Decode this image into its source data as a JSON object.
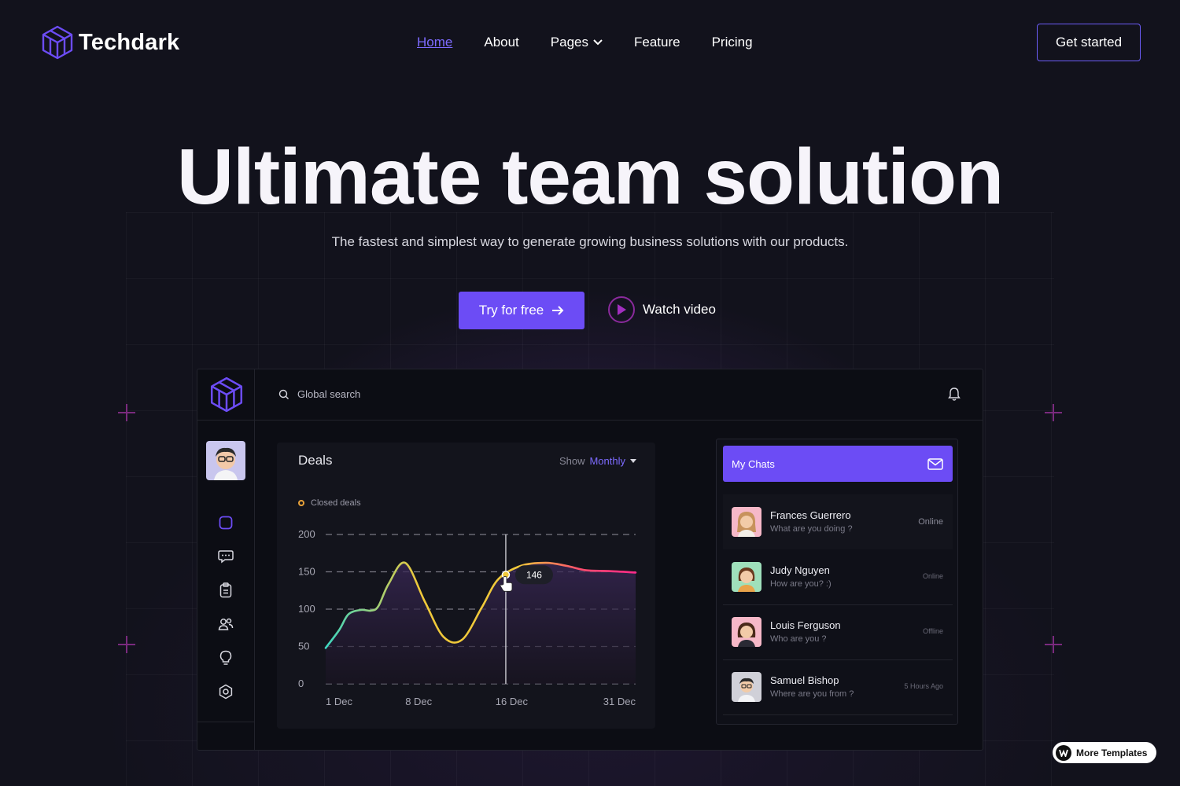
{
  "brand": {
    "name": "Techdark"
  },
  "nav": {
    "items": [
      {
        "label": "Home"
      },
      {
        "label": "About"
      },
      {
        "label": "Pages"
      },
      {
        "label": "Feature"
      },
      {
        "label": "Pricing"
      }
    ],
    "cta": "Get started"
  },
  "hero": {
    "title": "Ultimate team solution",
    "subtitle": "The fastest and simplest way to generate growing business solutions with our products.",
    "primary_button": "Try for free",
    "secondary_button": "Watch video"
  },
  "dashboard": {
    "search_placeholder": "Global search",
    "deals": {
      "title": "Deals",
      "show_label": "Show",
      "period": "Monthly",
      "legend": "Closed deals",
      "tooltip_value": "146"
    },
    "chats": {
      "title": "My Chats",
      "items": [
        {
          "name": "Frances Guerrero",
          "message": "What are you doing ?",
          "status": "Online"
        },
        {
          "name": "Judy Nguyen",
          "message": "How are you? :)",
          "status": "Online"
        },
        {
          "name": "Louis Ferguson",
          "message": "Who are you ?",
          "status": "Offline"
        },
        {
          "name": "Samuel Bishop",
          "message": "Where are you from ?",
          "status": "5 Hours Ago"
        }
      ]
    }
  },
  "badge": {
    "label": "More Templates"
  },
  "chart_data": {
    "type": "line",
    "legend": [
      "Closed deals"
    ],
    "x_tick_labels": [
      "1 Dec",
      "8 Dec",
      "16 Dec",
      "31 Dec"
    ],
    "y_tick_labels": [
      "0",
      "50",
      "100",
      "150",
      "200"
    ],
    "ylim": [
      0,
      200
    ],
    "x": [
      0,
      1.3,
      2.2,
      3.4,
      4.4,
      5.1,
      6.1,
      7.7,
      9.6,
      11.4,
      13.2,
      15.1,
      16.7,
      18.9,
      21.3,
      23.3,
      25.2,
      27.4,
      30
    ],
    "series": [
      {
        "name": "Closed deals",
        "values": [
          48,
          72,
          93,
          99,
          98,
          104,
          134,
          162,
          110,
          63,
          59,
          102,
          140,
          158,
          162,
          158,
          152,
          151,
          149
        ]
      }
    ],
    "highlight": {
      "value": 146
    },
    "grid": true,
    "colors": {
      "gradient": [
        "#3dd6c0",
        "#f0c93a",
        "#ff4d6d",
        "#ff2a8a"
      ],
      "accent": "#6c4cf5"
    }
  }
}
